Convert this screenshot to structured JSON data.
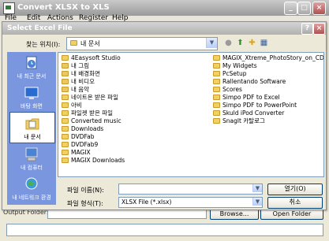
{
  "app": {
    "title": "Convert XLSX to XLS",
    "menu": [
      "File",
      "Edit",
      "Actions",
      "Register",
      "Help"
    ],
    "output_folder_label": "Output Folder:",
    "browse_label": "Browse...",
    "open_folder_label": "Open Folder"
  },
  "dialog": {
    "title": "Select Excel File",
    "lookin_label": "찾는 위치(I):",
    "lookin_value": "내 문서",
    "places": [
      {
        "label": "내 최근 문서",
        "icon": "recent-documents-icon"
      },
      {
        "label": "바탕 화면",
        "icon": "desktop-icon"
      },
      {
        "label": "내 문서",
        "icon": "my-documents-icon"
      },
      {
        "label": "내 컴퓨터",
        "icon": "my-computer-icon"
      },
      {
        "label": "내 네트워크 환경",
        "icon": "network-icon"
      }
    ],
    "files_col1": [
      "4Easysoft Studio",
      "내 그림",
      "내 배경화면",
      "내 비디오",
      "내 음악",
      "네이트온 받은 파일",
      "아비",
      "파일켓 받은 파일",
      "Converted music",
      "Downloads",
      "DVDFab",
      "DVDFab9",
      "MAGIX",
      "MAGIX Downloads"
    ],
    "files_col2": [
      "MAGIX_Xtreme_PhotoStory_on_CD_6",
      "My Widgets",
      "PcSetup",
      "Rallentando Software",
      "Scores",
      "Simpo PDF to Excel",
      "Simpo PDF to PowerPoint",
      "Skuld iPod Converter",
      "Snaglt 카탈로그"
    ],
    "filename_label": "파일 이름(N):",
    "filename_value": "",
    "filetype_label": "파일 형식(T):",
    "filetype_value": "XLSX File (*.xlsx)",
    "open_label": "열기(O)",
    "cancel_label": "취소"
  }
}
